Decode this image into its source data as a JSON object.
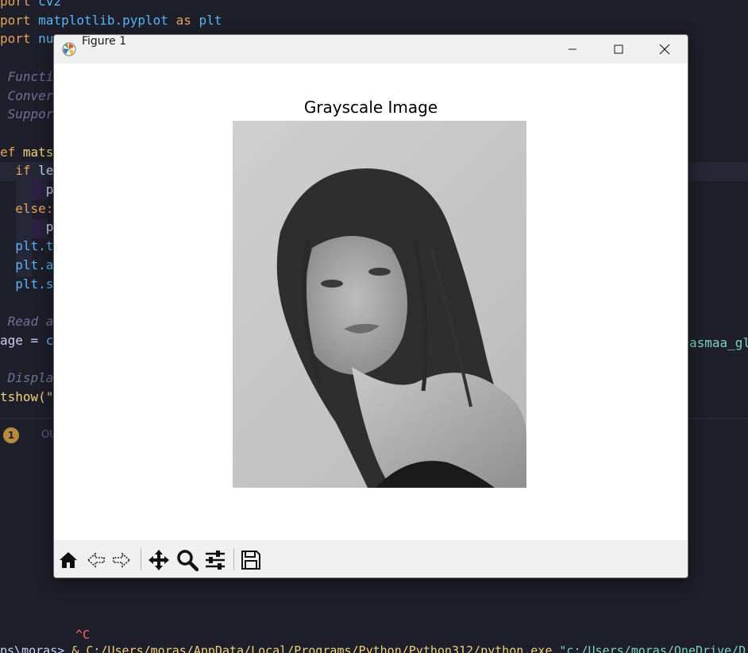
{
  "editor": {
    "lines": [
      {
        "segments": [
          {
            "t": "port ",
            "c": "kw-orange"
          },
          {
            "t": "cv2",
            "c": "kw-blue"
          }
        ]
      },
      {
        "segments": [
          {
            "t": "port ",
            "c": "kw-orange"
          },
          {
            "t": "matplotlib.pyplot ",
            "c": "kw-blue"
          },
          {
            "t": "as ",
            "c": "kw-orange"
          },
          {
            "t": "plt",
            "c": "kw-blue"
          }
        ]
      },
      {
        "segments": [
          {
            "t": "port ",
            "c": "kw-orange"
          },
          {
            "t": "nu",
            "c": "kw-blue"
          }
        ]
      },
      {
        "segments": []
      },
      {
        "segments": [
          {
            "t": " Functio",
            "c": "cmt"
          }
        ]
      },
      {
        "segments": [
          {
            "t": " Convert",
            "c": "cmt"
          }
        ]
      },
      {
        "segments": [
          {
            "t": " Support",
            "c": "cmt"
          }
        ]
      },
      {
        "segments": []
      },
      {
        "segments": [
          {
            "t": "ef ",
            "c": "kw-orange"
          },
          {
            "t": "matsh",
            "c": "fn-yellow"
          }
        ]
      },
      {
        "segments": [
          {
            "t": "  if ",
            "c": "kw-orange"
          },
          {
            "t": "le",
            "c": ""
          }
        ]
      },
      {
        "segments": [
          {
            "t": "      p",
            "c": ""
          }
        ]
      },
      {
        "segments": [
          {
            "t": "  else:",
            "c": "kw-orange"
          }
        ]
      },
      {
        "segments": [
          {
            "t": "      p",
            "c": ""
          }
        ]
      },
      {
        "segments": [
          {
            "t": "  plt.t",
            "c": "kw-blue"
          }
        ]
      },
      {
        "segments": [
          {
            "t": "  plt.a",
            "c": "kw-blue"
          }
        ]
      },
      {
        "segments": [
          {
            "t": "  plt.s",
            "c": "kw-blue"
          }
        ]
      },
      {
        "segments": []
      },
      {
        "segments": [
          {
            "t": " Read an",
            "c": "cmt"
          }
        ]
      },
      {
        "segments": [
          {
            "t": "age = ",
            "c": ""
          },
          {
            "t": "c",
            "c": "kw-blue"
          }
        ]
      },
      {
        "segments": []
      },
      {
        "segments": [
          {
            "t": " Display",
            "c": "cmt"
          }
        ]
      },
      {
        "segments": [
          {
            "t": "tshow(\"",
            "c": "fn-yellow"
          }
        ]
      }
    ],
    "right_fragment": "asmaa_gl",
    "problems_count": "1",
    "problems_label": "OU",
    "ctrl_c": "^C",
    "terminal_prompt": "ps\\moras> ",
    "terminal_path": "& C:/Users/moras/AppData/Local/Programs/Python/Python312/python.exe ",
    "terminal_arg": "\"c:/Users/moras/OneDrive/D"
  },
  "window": {
    "title": "Figure 1",
    "plot_title": "Grayscale Image"
  },
  "toolbar": {
    "buttons": [
      "home-icon",
      "back-icon",
      "forward-icon",
      "pan-icon",
      "zoom-icon",
      "configure-subplots-icon",
      "save-icon"
    ]
  }
}
